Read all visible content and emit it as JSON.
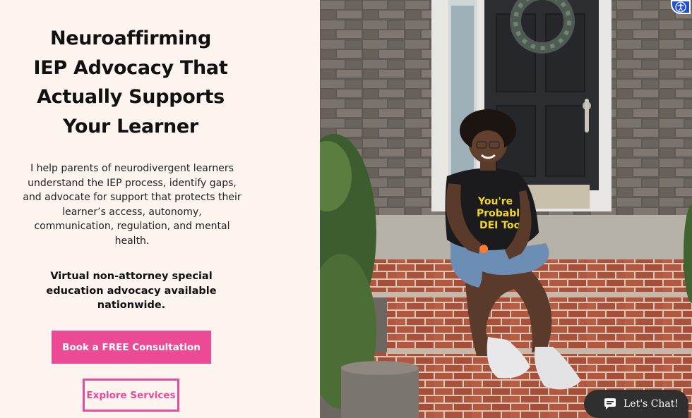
{
  "hero": {
    "title_lines": [
      "Neuroaffirming",
      "IEP Advocacy That",
      "Actually Supports",
      "Your Learner"
    ],
    "description": "I help parents of neurodivergent learners understand the IEP process, identify gaps, and advocate for support that protects their learner’s access, autonomy, communication, regulation, and mental health.",
    "note": "Virtual non-attorney special education advocacy available nationwide.",
    "primary_cta": "Book a FREE Consultation",
    "secondary_cta": "Explore Services"
  },
  "photo": {
    "shirt_text": [
      "You're",
      "Probably",
      "DEI Too."
    ]
  },
  "widgets": {
    "chat_label": "Let's Chat!",
    "accessibility_icon": "accessibility-icon",
    "chat_icon": "chat-bubble-icon"
  },
  "colors": {
    "accent": "#ec4a94",
    "background": "#fdf3ef",
    "chat_bg": "#2f2f2f",
    "a11y_blue": "#1d4ed8"
  }
}
